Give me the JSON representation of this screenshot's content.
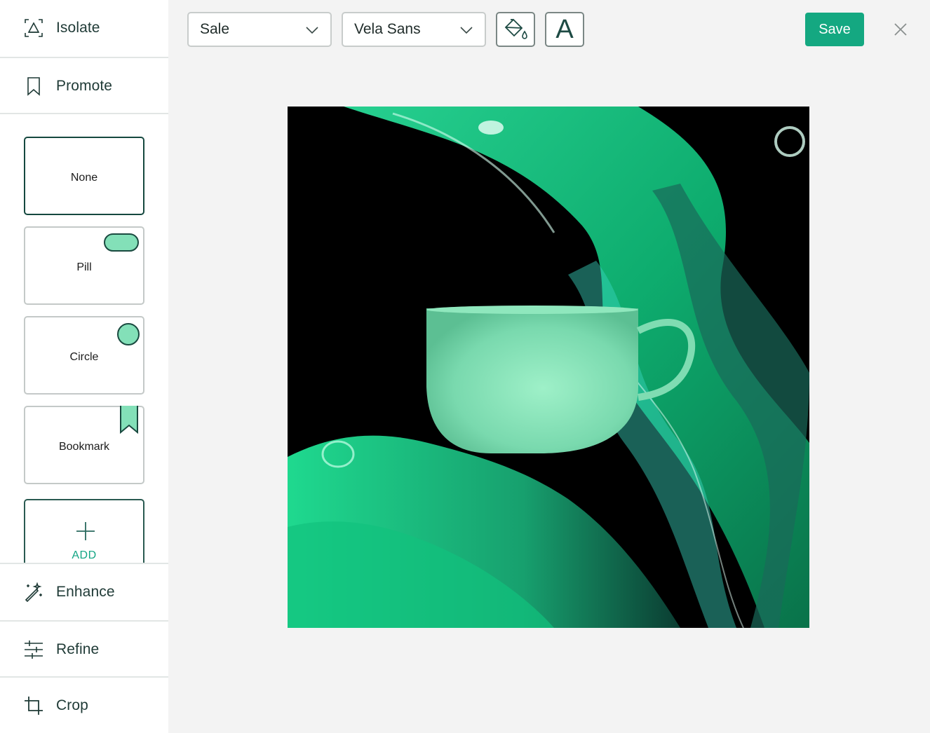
{
  "sidebar": {
    "top_items": [
      {
        "label": "Isolate",
        "icon": "isolate-icon"
      },
      {
        "label": "Promote",
        "icon": "bookmark-icon"
      }
    ],
    "badge_options": [
      {
        "label": "None",
        "selected": true
      },
      {
        "label": "Pill",
        "selected": false
      },
      {
        "label": "Circle",
        "selected": false
      },
      {
        "label": "Bookmark",
        "selected": false
      }
    ],
    "add_label": "ADD",
    "bottom_items": [
      {
        "label": "Enhance",
        "icon": "magic-wand-icon"
      },
      {
        "label": "Refine",
        "icon": "sliders-icon"
      },
      {
        "label": "Crop",
        "icon": "crop-icon"
      }
    ]
  },
  "toolbar": {
    "badge_text_select": "Sale",
    "font_select": "Vela Sans",
    "fill_icon": "paint-bucket-icon",
    "text_icon_glyph": "A",
    "save_label": "Save",
    "close_icon": "close-icon"
  },
  "colors": {
    "accent": "#14a881",
    "badge_fill": "#83e0b8",
    "dark_green": "#1a4a40"
  }
}
